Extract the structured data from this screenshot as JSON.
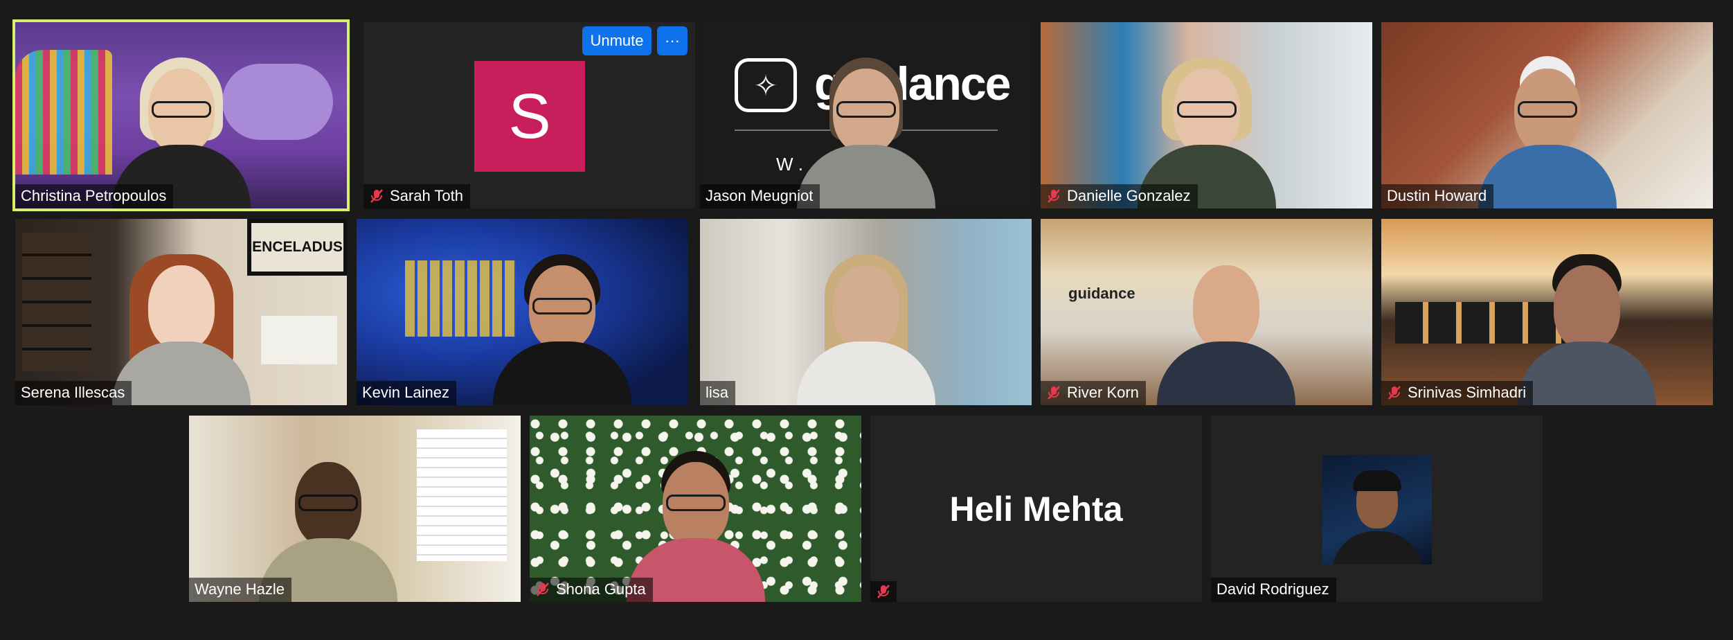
{
  "controls": {
    "unmute_label": "Unmute",
    "more_label": "···"
  },
  "logo": {
    "brand": "guidance",
    "tagline_partial": "W                       ."
  },
  "poster": {
    "text": "ENCELADUS"
  },
  "participants": [
    {
      "name": "Christina Petropoulos",
      "muted": false,
      "active_speaker": true,
      "video": true
    },
    {
      "name": "Sarah Toth",
      "muted": true,
      "video": false,
      "avatar_letter": "S",
      "avatar_color": "#c81e5b"
    },
    {
      "name": "Jason Meugniot",
      "muted": false,
      "video": true
    },
    {
      "name": "Danielle Gonzalez",
      "muted": true,
      "video": true
    },
    {
      "name": "Dustin Howard",
      "muted": false,
      "video": true
    },
    {
      "name": "Serena Illescas",
      "muted": false,
      "video": true
    },
    {
      "name": "Kevin Lainez",
      "muted": false,
      "video": true
    },
    {
      "name": "lisa",
      "muted": false,
      "video": true
    },
    {
      "name": "River Korn",
      "muted": true,
      "video": true
    },
    {
      "name": "Srinivas Simhadri",
      "muted": true,
      "video": true
    },
    {
      "name": "Wayne Hazle",
      "muted": false,
      "video": true
    },
    {
      "name": "Shona Gupta",
      "muted": true,
      "video": true
    },
    {
      "name": "Heli Mehta",
      "muted": true,
      "video": false
    },
    {
      "name": "David Rodriguez",
      "muted": false,
      "video": false,
      "has_photo": true
    }
  ],
  "colors": {
    "active_border": "#d8ef6a",
    "button_blue": "#0e72ed",
    "muted_red": "#e8384f",
    "background": "#1a1a1a",
    "tile": "#232323"
  }
}
